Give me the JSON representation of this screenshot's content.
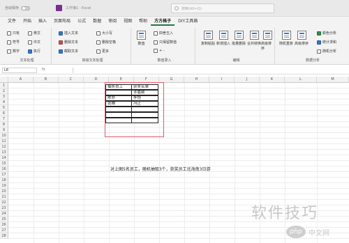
{
  "title_bar": {
    "autosave_label": "自动保存",
    "document_name": "工作簿1 - Excel",
    "search_placeholder": "搜索(Alt+Q)"
  },
  "menu": {
    "tabs": [
      "文件",
      "开始",
      "插入",
      "页面布局",
      "公式",
      "数据",
      "审阅",
      "视图",
      "帮助",
      "方方格子",
      "DIY工具箱"
    ],
    "active_tab": "方方格子"
  },
  "ribbon": {
    "text_group": {
      "items": [
        "只有",
        "英文",
        "符号",
        "中文",
        "数字",
        "执行"
      ],
      "label": "文本处理"
    },
    "adv_group": {
      "items": [
        "插入文本",
        "删除文本",
        "截取文本"
      ],
      "label": "高级文本处理"
    },
    "misc_group": {
      "items": [
        "大小写",
        "删除空格",
        "更多"
      ]
    },
    "numbers_group": {
      "big": "数值",
      "items": [
        "四舍五入",
        "只保留数值",
        "+ -"
      ],
      "label": "数值录入"
    },
    "edit_group": {
      "buttons": [
        "复制粘贴",
        "新增插入",
        "批量删除",
        "合并转换",
        "高级排序"
      ],
      "label": "编辑"
    },
    "analysis_group": {
      "buttons": [
        "随机重复",
        "高级排序"
      ],
      "items": [
        "颜色分析",
        "统计求和",
        "随机分析"
      ],
      "label": "数据分析"
    }
  },
  "formula_bar": {
    "name_box": "L8",
    "fx": "fx"
  },
  "sheet": {
    "columns": [
      "A",
      "B",
      "C",
      "D",
      "E",
      "F",
      "G",
      "H",
      "I",
      "J",
      "K",
      "L",
      "M"
    ],
    "rows": [
      "1",
      "2",
      "3",
      "4",
      "5",
      "6",
      "7",
      "8",
      "9",
      "10",
      "11",
      "12",
      "13",
      "14",
      "15",
      "16",
      "17",
      "18",
      "19",
      "20",
      "21",
      "22",
      "23",
      "24",
      "25",
      "26",
      "27",
      "28"
    ],
    "table": {
      "header": [
        "抽奖员工",
        "获奖名单"
      ],
      "rows": [
        [
          "",
          "许嘉颖"
        ],
        [
          "陈亦",
          "李恺"
        ],
        [
          "张婵",
          "冯正"
        ],
        [
          "",
          ""
        ],
        [
          "",
          ""
        ],
        [
          "",
          ""
        ]
      ]
    },
    "note": "对上图5名员工，随机抽取3个，获奖员工北海南3日游"
  },
  "watermark": {
    "text": "软件技巧",
    "logo": "php",
    "sub": "中文网"
  }
}
